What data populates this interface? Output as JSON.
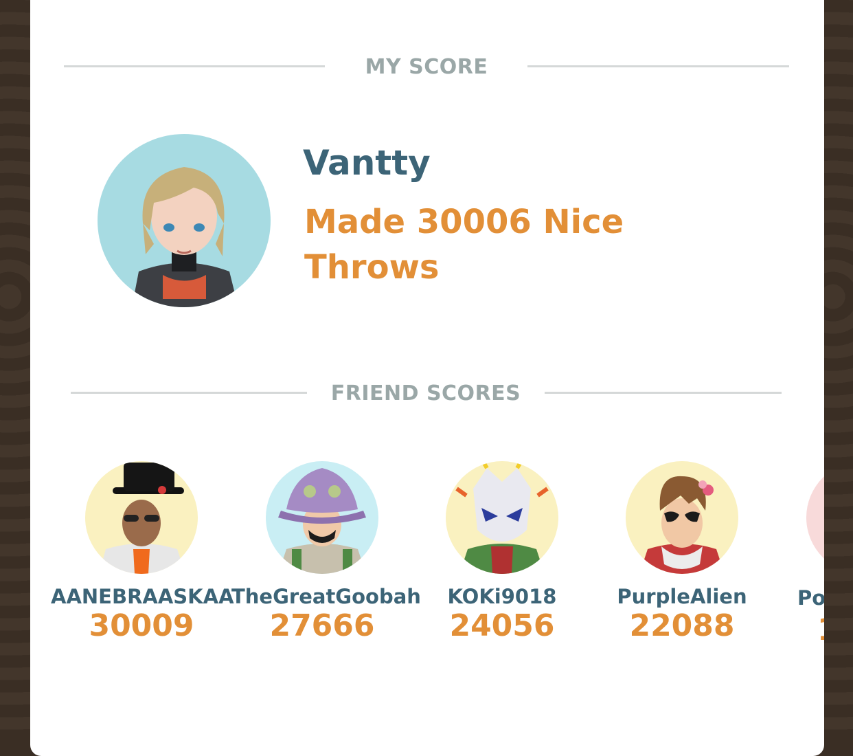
{
  "my_score_section": {
    "header": "MY SCORE"
  },
  "player": {
    "name": "Vantty",
    "score_text": "Made 30006 Nice Throws",
    "avatar_bg": "#a7dbe2"
  },
  "friend_section": {
    "header": "FRIEND SCORES"
  },
  "friends": [
    {
      "name": "AANEBRAASKAA",
      "score": "30009",
      "avatar_bg": "#faf1c0",
      "avatar_icon": "trainer-tophat-avatar-icon"
    },
    {
      "name": "TheGreatGoobah",
      "score": "27666",
      "avatar_bg": "#c9eef4",
      "avatar_icon": "trainer-buckethat-avatar-icon"
    },
    {
      "name": "KOKi9018",
      "score": "24056",
      "avatar_bg": "#faf1c0",
      "avatar_icon": "trainer-mask-avatar-icon"
    },
    {
      "name": "PurpleAlien",
      "score": "22088",
      "avatar_bg": "#faf1c0",
      "avatar_icon": "trainer-sunglasses-avatar-icon"
    },
    {
      "name": "Po",
      "score": "1",
      "avatar_bg": "#f8dada",
      "avatar_icon": "trainer-avatar-icon"
    }
  ],
  "colors": {
    "name": "#3c6477",
    "score": "#e28f37",
    "section_label": "#9aa7a7"
  }
}
